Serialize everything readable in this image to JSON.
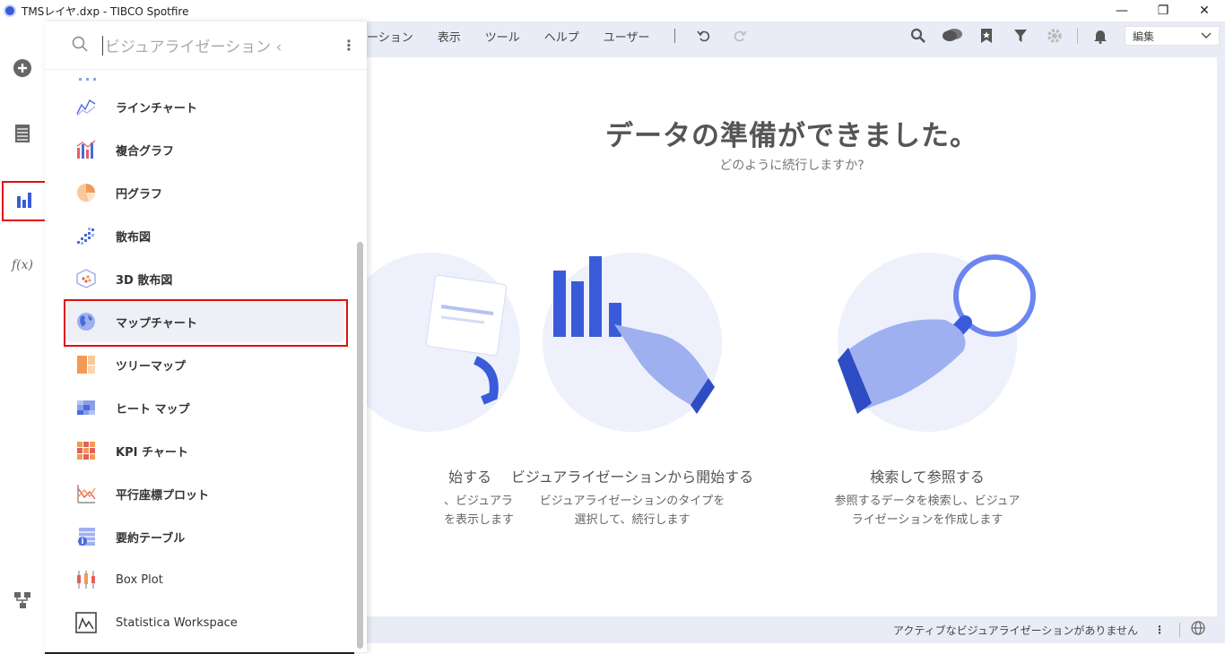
{
  "window": {
    "title": "TMSレイヤ.dxp - TIBCO Spotfire",
    "controls": [
      "—",
      "❐",
      "✕"
    ]
  },
  "menubar": {
    "items": [
      "ーション",
      "表示",
      "ツール",
      "ヘルプ",
      "ユーザー"
    ],
    "mode_value": "編集"
  },
  "rail": {
    "items": [
      "add-data",
      "data-table",
      "visualization-types",
      "expressions",
      "data-canvas"
    ],
    "expression_label": "f(x)"
  },
  "flyout": {
    "search_placeholder": "ビジュアライゼーション ‹",
    "items": [
      {
        "label": "ラインチャート",
        "icon": "line-chart-icon"
      },
      {
        "label": "複合グラフ",
        "icon": "combination-chart-icon"
      },
      {
        "label": "円グラフ",
        "icon": "pie-chart-icon"
      },
      {
        "label": "散布図",
        "icon": "scatter-plot-icon"
      },
      {
        "label": "3D 散布図",
        "icon": "3d-scatter-plot-icon"
      },
      {
        "label": "マップチャート",
        "icon": "map-chart-icon"
      },
      {
        "label": "ツリーマップ",
        "icon": "treemap-icon"
      },
      {
        "label": "ヒート マップ",
        "icon": "heat-map-icon"
      },
      {
        "label": "KPI チャート",
        "icon": "kpi-chart-icon"
      },
      {
        "label": "平行座標プロット",
        "icon": "parallel-coordinate-icon"
      },
      {
        "label": "要約テーブル",
        "icon": "summary-table-icon"
      },
      {
        "label": "Box Plot",
        "icon": "box-plot-icon"
      },
      {
        "label": "Statistica Workspace",
        "icon": "statistica-workspace-icon"
      }
    ],
    "selected_label": "マップチャート"
  },
  "canvas": {
    "headline": "データの準備ができました。",
    "subline": "どのように続行しますか?",
    "cards": [
      {
        "title": "始する",
        "desc1": "、ビジュアラ",
        "desc2": "を表示します"
      },
      {
        "title": "ビジュアライゼーションから開始する",
        "desc1": "ビジュアライゼーションのタイプを",
        "desc2": "選択して、続行します"
      },
      {
        "title": "検索して参照する",
        "desc1": "参照するデータを検索し、ビジュア",
        "desc2": "ライゼーションを作成します"
      }
    ]
  },
  "status": {
    "text": "アクティブなビジュアライゼーションがありません"
  },
  "colors": {
    "accent": "#3a5bd9",
    "highlight": "#e01010",
    "menubar_bg": "#e9ecf6"
  }
}
